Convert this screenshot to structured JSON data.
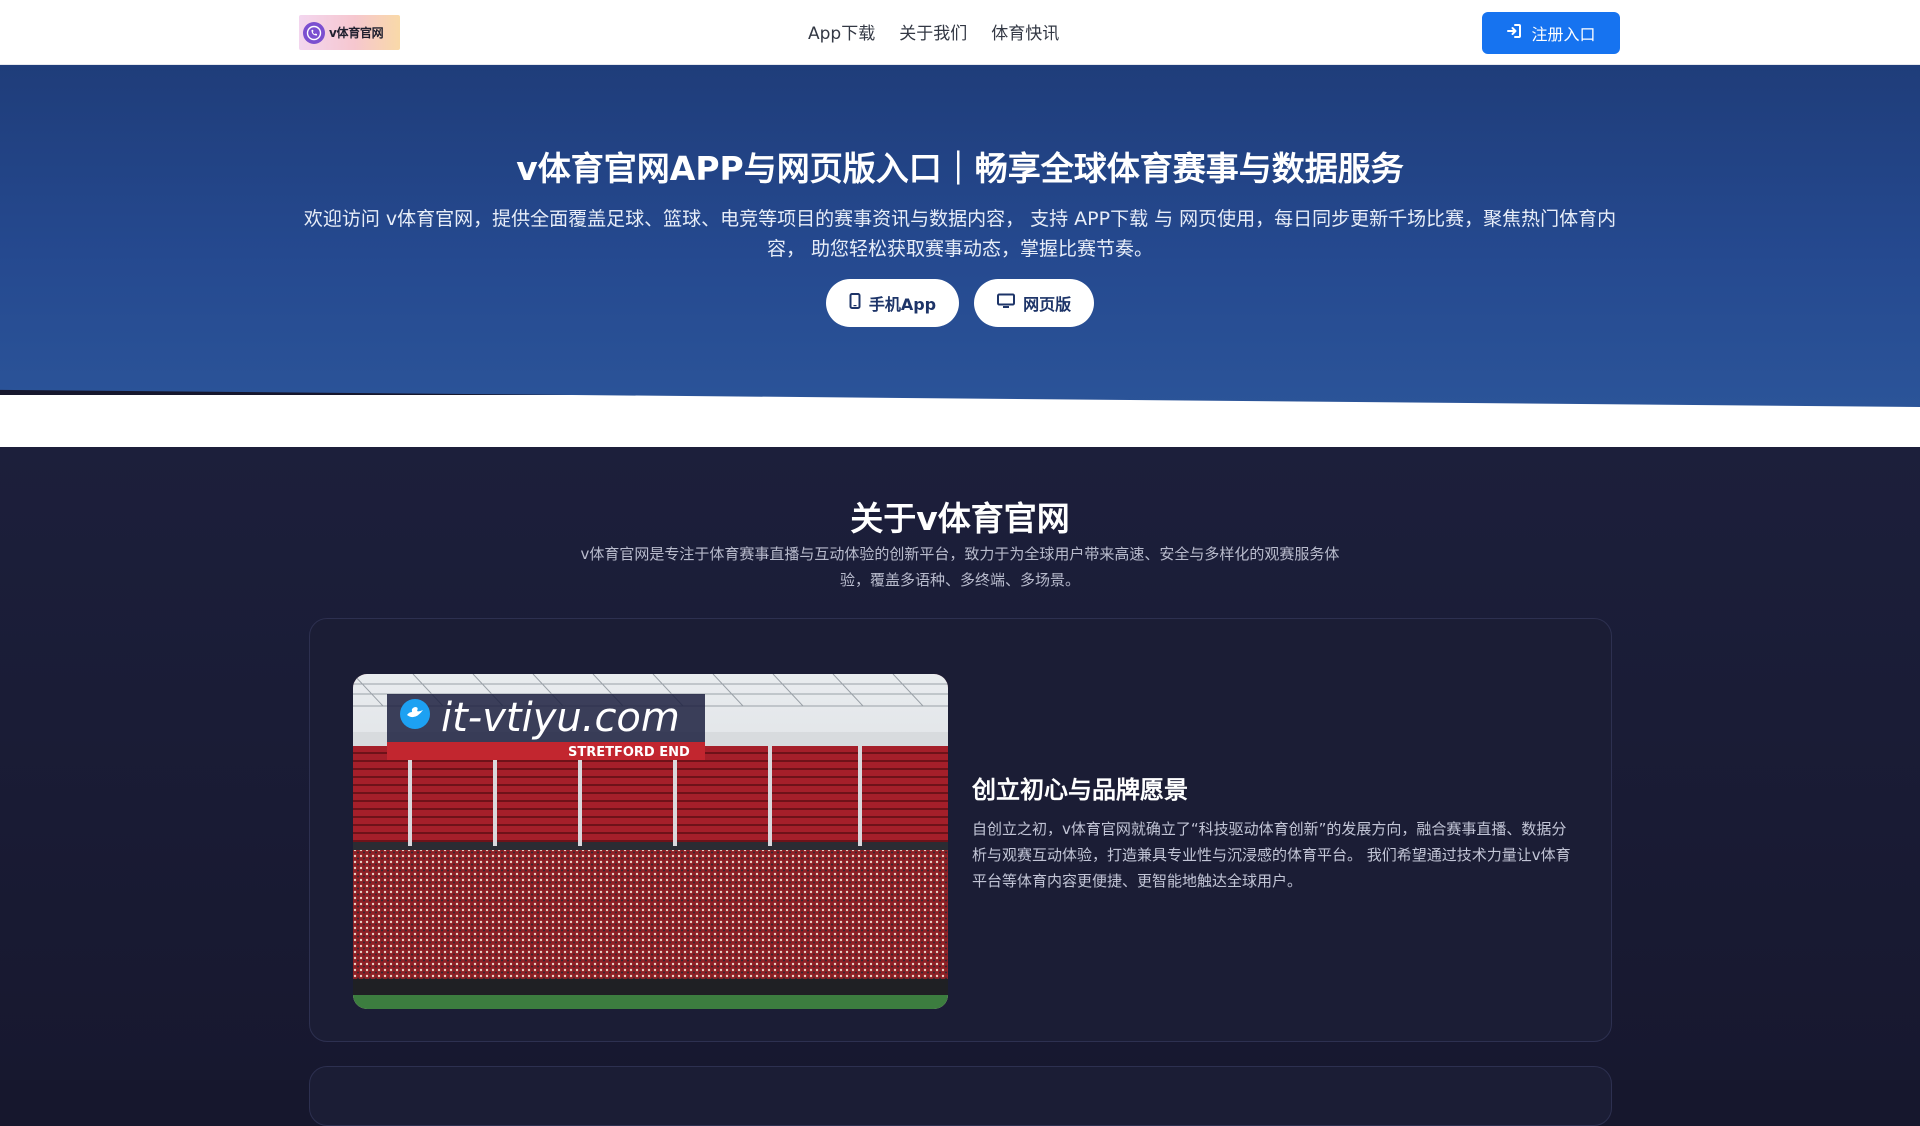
{
  "header": {
    "logo_text": "v体育官网",
    "nav": [
      "App下载",
      "关于我们",
      "体育快讯"
    ],
    "register_label": "注册入口"
  },
  "hero": {
    "title": "v体育官网APP与网页版入口｜畅享全球体育赛事与数据服务",
    "description": "欢迎访问 v体育官网，提供全面覆盖足球、篮球、电竞等项目的赛事资讯与数据内容， 支持 APP下载 与 网页使用，每日同步更新千场比赛，聚焦热门体育内容， 助您轻松获取赛事动态，掌握比赛节奏。",
    "buttons": [
      {
        "label": "手机App",
        "icon": "mobile-icon"
      },
      {
        "label": "网页版",
        "icon": "desktop-icon"
      }
    ]
  },
  "about": {
    "title": "关于v体育官网",
    "description": "v体育官网是专注于体育赛事直播与互动体验的创新平台，致力于为全球用户带来高速、安全与多样化的观赛服务体验，覆盖多语种、多终端、多场景。",
    "card": {
      "image_watermark": "it-vtiyu.com",
      "image_banner": "STRETFORD END",
      "title": "创立初心与品牌愿景",
      "text": "自创立之初，v体育官网就确立了“科技驱动体育创新”的发展方向，融合赛事直播、数据分析与观赛互动体验，打造兼具专业性与沉浸感的体育平台。 我们希望通过技术力量让v体育平台等体育内容更便捷、更智能地触达全球用户。"
    }
  },
  "colors": {
    "accent": "#1673f0",
    "hero_bg": "#25498f",
    "section_bg": "#17182f"
  }
}
